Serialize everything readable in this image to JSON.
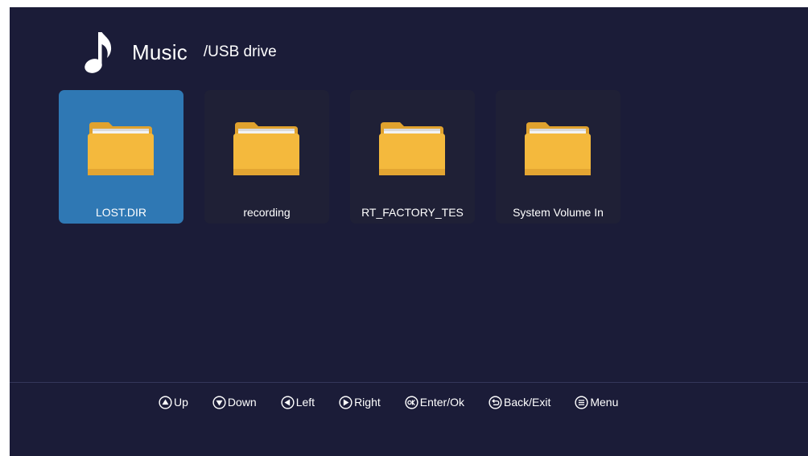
{
  "header": {
    "title": "Music",
    "path": "/USB drive",
    "icon": "music-note-icon"
  },
  "folders": [
    {
      "name": "LOST.DIR",
      "selected": true
    },
    {
      "name": "recording",
      "selected": false
    },
    {
      "name": "RT_FACTORY_TES",
      "selected": false
    },
    {
      "name": "System Volume In",
      "selected": false
    }
  ],
  "hints": [
    {
      "label": "Up",
      "icon": "up-arrow-icon"
    },
    {
      "label": "Down",
      "icon": "down-arrow-icon"
    },
    {
      "label": "Left",
      "icon": "left-arrow-icon"
    },
    {
      "label": "Right",
      "icon": "right-arrow-icon"
    },
    {
      "label": "Enter/Ok",
      "icon": "ok-icon"
    },
    {
      "label": "Back/Exit",
      "icon": "back-icon"
    },
    {
      "label": "Menu",
      "icon": "menu-icon"
    }
  ],
  "colors": {
    "background": "#1b1c38",
    "tile": "#1f2036",
    "tile_selected": "#2f78b4",
    "folder": "#f2b63a"
  }
}
